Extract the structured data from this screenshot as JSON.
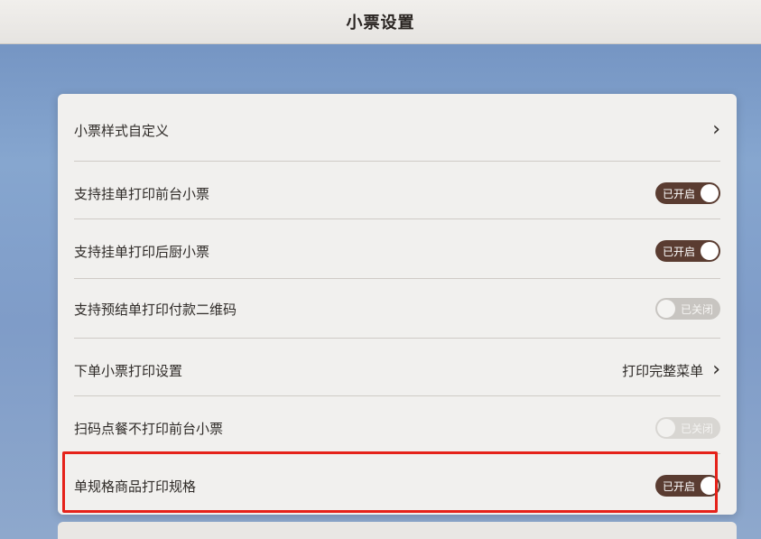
{
  "header": {
    "title": "小票设置"
  },
  "settings": [
    {
      "label": "小票样式自定义",
      "type": "link"
    },
    {
      "label": "支持挂单打印前台小票",
      "type": "toggle",
      "state": "on",
      "toggle_text": "已开启"
    },
    {
      "label": "支持挂单打印后厨小票",
      "type": "toggle",
      "state": "on",
      "toggle_text": "已开启"
    },
    {
      "label": "支持预结单打印付款二维码",
      "type": "toggle",
      "state": "off",
      "toggle_text": "已关闭"
    },
    {
      "label": "下单小票打印设置",
      "type": "link",
      "value": "打印完整菜单"
    },
    {
      "label": "扫码点餐不打印前台小票",
      "type": "toggle",
      "state": "off",
      "disabled": true,
      "toggle_text": "已关闭"
    },
    {
      "label": "单规格商品打印规格",
      "type": "toggle",
      "state": "on",
      "toggle_text": "已开启"
    }
  ],
  "colors": {
    "toggle_on": "#5a3c31",
    "toggle_off": "#c8c5c1",
    "highlight_border": "#e5221a"
  },
  "icons": {
    "chevron": "chevron-right-icon"
  }
}
